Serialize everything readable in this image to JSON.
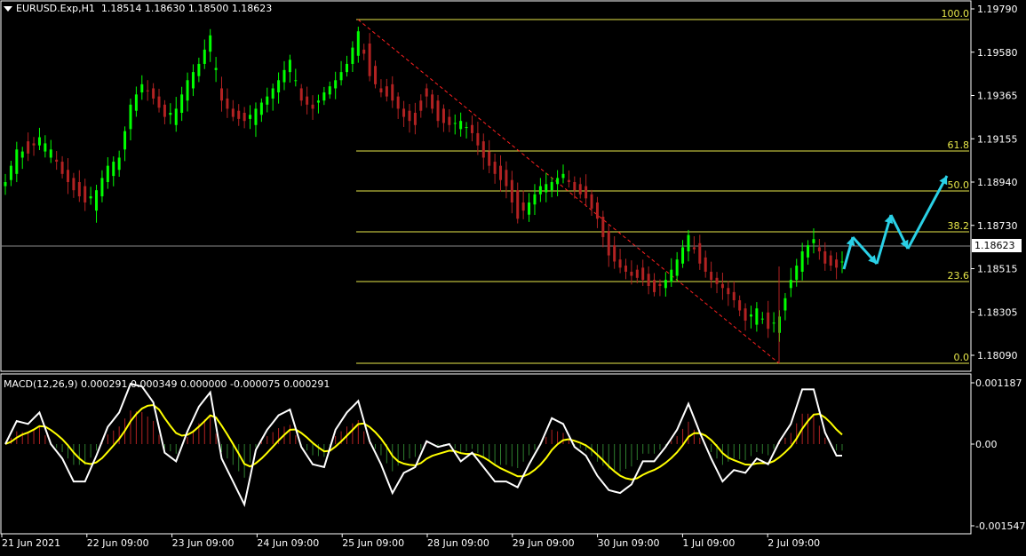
{
  "header": {
    "symbol": "EURUSD.Exp,H1",
    "ohlc": "1.18514 1.18630 1.18500 1.18623"
  },
  "colors": {
    "background": "#000000",
    "bull": "#00ff00",
    "bear": "#b22222",
    "fib": "#e8e84a",
    "macd_hist_pos": "#b22222",
    "macd_hist_neg": "#2e7d2e",
    "macd_line": "#ffffff",
    "signal_line": "#ffff00",
    "arrow": "#2ad0e6",
    "trend": "#ff2020"
  },
  "price_axis": [
    "1.19790",
    "1.19580",
    "1.19365",
    "1.19155",
    "1.18940",
    "1.18730",
    "1.18515",
    "1.18305",
    "1.18090"
  ],
  "current_price": "1.18623",
  "fib_levels": [
    {
      "label": "100.0",
      "price": 1.19775
    },
    {
      "label": "61.8",
      "price": 1.191
    },
    {
      "label": "50.0",
      "price": 1.1889
    },
    {
      "label": "38.2",
      "price": 1.1868
    },
    {
      "label": "23.6",
      "price": 1.1842
    },
    {
      "label": "0.0",
      "price": 1.18055
    }
  ],
  "macd": {
    "label": "MACD(12,26,9) 0.000291 0.000349 0.000000 -0.000075 0.000291",
    "axis": [
      "0.001187",
      "0.00",
      "-0.001547"
    ]
  },
  "time_axis": [
    "21 Jun 2021",
    "22 Jun 09:00",
    "23 Jun 09:00",
    "24 Jun 09:00",
    "25 Jun 09:00",
    "28 Jun 09:00",
    "29 Jun 09:00",
    "30 Jun 09:00",
    "1 Jul 09:00",
    "2 Jul 09:00"
  ],
  "chart_data": {
    "type": "candlestick",
    "price_range": [
      1.18,
      1.198
    ],
    "close_path": [
      [
        1.1892,
        1.1894
      ],
      [
        1.1898,
        1.191
      ],
      [
        1.1914,
        1.1908
      ],
      [
        1.1912,
        1.1916
      ],
      [
        1.1906,
        1.191
      ],
      [
        1.1904,
        1.1898
      ],
      [
        1.1896,
        1.189
      ],
      [
        1.1892,
        1.1884
      ],
      [
        1.188,
        1.189
      ],
      [
        1.1894,
        1.1902
      ],
      [
        1.19,
        1.1906
      ],
      [
        1.192,
        1.1932
      ],
      [
        1.1938,
        1.1942
      ],
      [
        1.194,
        1.1935
      ],
      [
        1.1932,
        1.1926
      ],
      [
        1.1922,
        1.193
      ],
      [
        1.1934,
        1.1944
      ],
      [
        1.1946,
        1.1952
      ],
      [
        1.1958,
        1.1966
      ],
      [
        1.194,
        1.1934
      ],
      [
        1.193,
        1.1926
      ],
      [
        1.1928,
        1.1924
      ],
      [
        1.1922,
        1.193
      ],
      [
        1.1932,
        1.1936
      ],
      [
        1.1938,
        1.1944
      ],
      [
        1.1948,
        1.1954
      ],
      [
        1.194,
        1.1934
      ],
      [
        1.1932,
        1.193
      ],
      [
        1.1934,
        1.1938
      ],
      [
        1.194,
        1.1944
      ],
      [
        1.1948,
        1.1952
      ],
      [
        1.1956,
        1.1968
      ],
      [
        1.1962,
        1.1946
      ],
      [
        1.194,
        1.1938
      ],
      [
        1.1942,
        1.1934
      ],
      [
        1.193,
        1.1926
      ],
      [
        1.1928,
        1.1922
      ],
      [
        1.194,
        1.1936
      ],
      [
        1.1934,
        1.1924
      ],
      [
        1.1926,
        1.1922
      ],
      [
        1.192,
        1.1924
      ],
      [
        1.1922,
        1.1918
      ],
      [
        1.1914,
        1.1906
      ],
      [
        1.1904,
        1.1898
      ],
      [
        1.19,
        1.1892
      ],
      [
        1.189,
        1.1876
      ],
      [
        1.1878,
        1.1884
      ],
      [
        1.1888,
        1.1892
      ],
      [
        1.189,
        1.1894
      ],
      [
        1.1896,
        1.1898
      ],
      [
        1.1894,
        1.189
      ],
      [
        1.1892,
        1.1886
      ],
      [
        1.1884,
        1.1876
      ],
      [
        1.187,
        1.1858
      ],
      [
        1.1856,
        1.1852
      ],
      [
        1.185,
        1.1848
      ],
      [
        1.1852,
        1.1846
      ],
      [
        1.1846,
        1.184
      ],
      [
        1.1842,
        1.1846
      ],
      [
        1.1848,
        1.1856
      ],
      [
        1.186,
        1.1868
      ],
      [
        1.1864,
        1.1854
      ],
      [
        1.185,
        1.1846
      ],
      [
        1.1844,
        1.1842
      ],
      [
        1.184,
        1.1836
      ],
      [
        1.1832,
        1.1826
      ],
      [
        1.1824,
        1.1832
      ],
      [
        1.183,
        1.1822
      ],
      [
        1.182,
        1.1828
      ],
      [
        1.1842,
        1.1846
      ],
      [
        1.185,
        1.186
      ],
      [
        1.1864,
        1.1866
      ],
      [
        1.186,
        1.1854
      ],
      [
        1.1856,
        1.1852
      ],
      [
        1.1854,
        1.1858
      ]
    ],
    "projection_arrows": [
      [
        [
          950,
          303
        ],
        [
          960,
          267
        ]
      ],
      [
        [
          960,
          267
        ],
        [
          987,
          297
        ]
      ],
      [
        [
          987,
          297
        ],
        [
          1003,
          242
        ]
      ],
      [
        [
          1003,
          242
        ],
        [
          1022,
          280
        ]
      ],
      [
        [
          1022,
          280
        ],
        [
          1066,
          198
        ]
      ]
    ]
  }
}
